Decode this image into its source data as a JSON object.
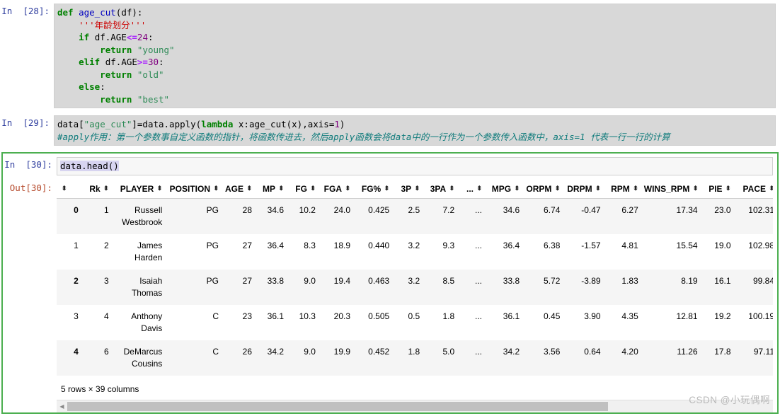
{
  "cells": [
    {
      "prompt": "In  [28]:",
      "type": "code",
      "code_lines": [
        "def age_cut(df):",
        "    '''年龄划分'''",
        "    if df.AGE<=24:",
        "        return \"young\"",
        "    elif df.AGE>=30:",
        "        return \"old\"",
        "    else:",
        "        return \"best\""
      ]
    },
    {
      "prompt": "In  [29]:",
      "type": "code",
      "code_lines": [
        "data[\"age_cut\"]=data.apply(lambda x:age_cut(x),axis=1)",
        "#apply作用：第一个参数事自定义函数的指针，将函数传进去，然后apply函数会将data中的一行作为一个参数传入函数中，axis=1 代表一行一行的计算"
      ]
    },
    {
      "prompt": "In  [30]:",
      "type": "code",
      "selected": true,
      "code_lines": [
        "data.head()"
      ]
    }
  ],
  "output": {
    "prompt": "Out[30]:",
    "shape_text": "5 rows × 39 columns",
    "sorter_glyph": "⬍",
    "scroll_left_arrow": "◀",
    "columns": [
      "Rk",
      "PLAYER",
      "POSITION",
      "AGE",
      "MP",
      "FG",
      "FGA",
      "FG%",
      "3P",
      "3PA",
      "...",
      "MPG",
      "ORPM",
      "DRPM",
      "RPM",
      "WINS_RPM",
      "PIE",
      "PACE"
    ],
    "rows": [
      {
        "index": "0",
        "values": [
          "1",
          "Russell Westbrook",
          "PG",
          "28",
          "34.6",
          "10.2",
          "24.0",
          "0.425",
          "2.5",
          "7.2",
          "...",
          "34.6",
          "6.74",
          "-0.47",
          "6.27",
          "17.34",
          "23.0",
          "102.31"
        ]
      },
      {
        "index": "1",
        "values": [
          "2",
          "James Harden",
          "PG",
          "27",
          "36.4",
          "8.3",
          "18.9",
          "0.440",
          "3.2",
          "9.3",
          "...",
          "36.4",
          "6.38",
          "-1.57",
          "4.81",
          "15.54",
          "19.0",
          "102.98"
        ]
      },
      {
        "index": "2",
        "values": [
          "3",
          "Isaiah Thomas",
          "PG",
          "27",
          "33.8",
          "9.0",
          "19.4",
          "0.463",
          "3.2",
          "8.5",
          "...",
          "33.8",
          "5.72",
          "-3.89",
          "1.83",
          "8.19",
          "16.1",
          "99.84"
        ]
      },
      {
        "index": "3",
        "values": [
          "4",
          "Anthony Davis",
          "C",
          "23",
          "36.1",
          "10.3",
          "20.3",
          "0.505",
          "0.5",
          "1.8",
          "...",
          "36.1",
          "0.45",
          "3.90",
          "4.35",
          "12.81",
          "19.2",
          "100.19"
        ]
      },
      {
        "index": "4",
        "values": [
          "6",
          "DeMarcus Cousins",
          "C",
          "26",
          "34.2",
          "9.0",
          "19.9",
          "0.452",
          "1.8",
          "5.0",
          "...",
          "34.2",
          "3.56",
          "0.64",
          "4.20",
          "11.26",
          "17.8",
          "97.11"
        ]
      }
    ]
  },
  "watermark": "CSDN @小玩偶啊",
  "colors": {
    "selection_green": "#4caf50",
    "in_prompt": "#303f9f",
    "out_prompt": "#b5482a",
    "cell_bg": "#d8d8d8",
    "row_alt": "#f5f5f5"
  }
}
